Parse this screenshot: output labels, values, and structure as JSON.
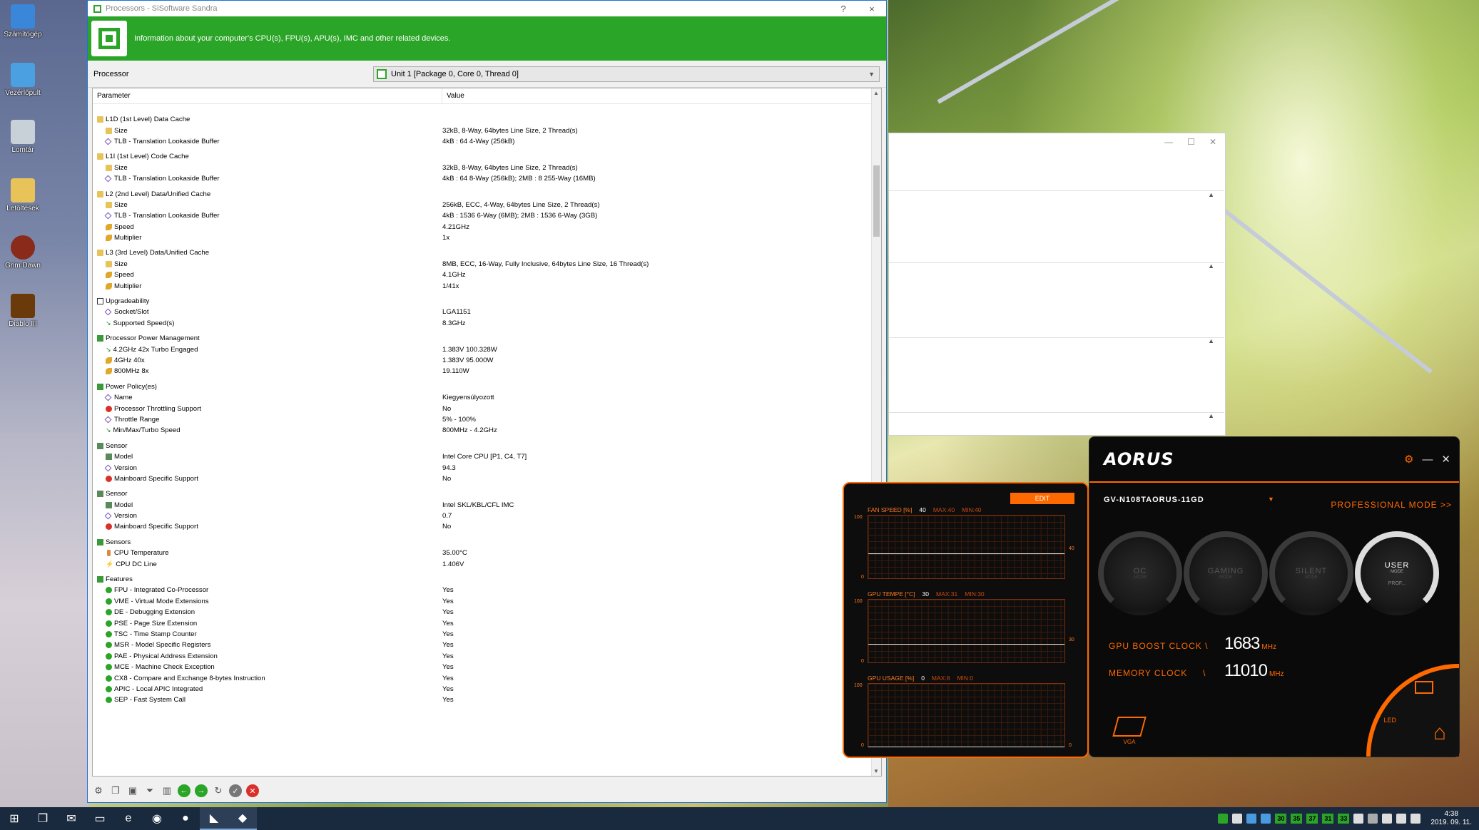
{
  "desktop": {
    "icons": [
      {
        "label": "Számítógép"
      },
      {
        "label": "Vezérlőpult"
      },
      {
        "label": "Lomtár"
      },
      {
        "label": "Letöltések"
      },
      {
        "label": "Grim Dawn"
      },
      {
        "label": "Diablo III"
      }
    ]
  },
  "sandra": {
    "title": "Processors - SiSoftware Sandra",
    "help_btn": "?",
    "close_btn": "×",
    "banner_text": "Information about your computer's CPU(s), FPU(s), APU(s), IMC and other related devices.",
    "processor_label": "Processor",
    "processor_value": "Unit 1 [Package 0, Core 0, Thread 0]",
    "col_param": "Parameter",
    "col_value": "Value",
    "rows": [
      {
        "t": "group",
        "icon": "folder",
        "p": "L1D (1st Level) Data Cache",
        "v": ""
      },
      {
        "t": "item",
        "icon": "folder",
        "p": "Size",
        "v": "32kB, 8-Way, 64bytes Line Size, 2 Thread(s)"
      },
      {
        "t": "item",
        "icon": "tlb",
        "p": "TLB - Translation Lookaside Buffer",
        "v": "4kB : 64 4-Way (256kB)"
      },
      {
        "t": "group",
        "icon": "folder",
        "p": "L1I (1st Level) Code Cache",
        "v": ""
      },
      {
        "t": "item",
        "icon": "folder",
        "p": "Size",
        "v": "32kB, 8-Way, 64bytes Line Size, 2 Thread(s)"
      },
      {
        "t": "item",
        "icon": "tlb",
        "p": "TLB - Translation Lookaside Buffer",
        "v": "4kB : 64 8-Way (256kB); 2MB : 8 255-Way (16MB)"
      },
      {
        "t": "group",
        "icon": "folder",
        "p": "L2 (2nd Level) Data/Unified Cache",
        "v": ""
      },
      {
        "t": "item",
        "icon": "folder",
        "p": "Size",
        "v": "256kB, ECC, 4-Way, 64bytes Line Size, 2 Thread(s)"
      },
      {
        "t": "item",
        "icon": "tlb",
        "p": "TLB - Translation Lookaside Buffer",
        "v": "4kB : 1536 6-Way (6MB); 2MB : 1536 6-Way (3GB)"
      },
      {
        "t": "item",
        "icon": "speed",
        "p": "Speed",
        "v": "4.21GHz"
      },
      {
        "t": "item",
        "icon": "speed",
        "p": "Multiplier",
        "v": "1x"
      },
      {
        "t": "group",
        "icon": "folder",
        "p": "L3 (3rd Level) Data/Unified Cache",
        "v": ""
      },
      {
        "t": "item",
        "icon": "folder",
        "p": "Size",
        "v": "8MB, ECC, 16-Way, Fully Inclusive, 64bytes Line Size, 16 Thread(s)"
      },
      {
        "t": "item",
        "icon": "speed",
        "p": "Speed",
        "v": "4.1GHz"
      },
      {
        "t": "item",
        "icon": "speed",
        "p": "Multiplier",
        "v": "1/41x"
      },
      {
        "t": "group",
        "icon": "box",
        "p": "Upgradeability",
        "v": ""
      },
      {
        "t": "item",
        "icon": "tlb",
        "p": "Socket/Slot",
        "v": "LGA1151"
      },
      {
        "t": "item",
        "icon": "arrow",
        "p": "Supported Speed(s)",
        "v": "8.3GHz"
      },
      {
        "t": "group",
        "icon": "power",
        "p": "Processor Power Management",
        "v": ""
      },
      {
        "t": "item",
        "icon": "arrow",
        "p": "4.2GHz 42x Turbo Engaged",
        "v": "1.383V 100.328W"
      },
      {
        "t": "item",
        "icon": "speed",
        "p": "4GHz 40x",
        "v": "1.383V 95.000W"
      },
      {
        "t": "item",
        "icon": "speed",
        "p": "800MHz 8x",
        "v": "19.110W"
      },
      {
        "t": "group",
        "icon": "power",
        "p": "Power Policy(es)",
        "v": ""
      },
      {
        "t": "item",
        "icon": "tlb",
        "p": "Name",
        "v": "Kiegyensúlyozott"
      },
      {
        "t": "item",
        "icon": "no",
        "p": "Processor Throttling Support",
        "v": "No"
      },
      {
        "t": "item",
        "icon": "tlb",
        "p": "Throttle Range",
        "v": "5% - 100%"
      },
      {
        "t": "item",
        "icon": "arrow",
        "p": "Min/Max/Turbo Speed",
        "v": "800MHz - 4.2GHz"
      },
      {
        "t": "group",
        "icon": "sensor",
        "p": "Sensor",
        "v": ""
      },
      {
        "t": "item",
        "icon": "sensor",
        "p": "Model",
        "v": "Intel Core CPU [P1, C4, T7]"
      },
      {
        "t": "item",
        "icon": "tlb",
        "p": "Version",
        "v": "94.3"
      },
      {
        "t": "item",
        "icon": "no",
        "p": "Mainboard Specific Support",
        "v": "No"
      },
      {
        "t": "group",
        "icon": "sensor",
        "p": "Sensor",
        "v": ""
      },
      {
        "t": "item",
        "icon": "sensor",
        "p": "Model",
        "v": "Intel SKL/KBL/CFL IMC"
      },
      {
        "t": "item",
        "icon": "tlb",
        "p": "Version",
        "v": "0.7"
      },
      {
        "t": "item",
        "icon": "no",
        "p": "Mainboard Specific Support",
        "v": "No"
      },
      {
        "t": "group",
        "icon": "power",
        "p": "Sensors",
        "v": ""
      },
      {
        "t": "item",
        "icon": "temp",
        "p": "CPU Temperature",
        "v": "35.00°C"
      },
      {
        "t": "item",
        "icon": "bolt",
        "p": "CPU DC Line",
        "v": "1.406V"
      },
      {
        "t": "group",
        "icon": "power",
        "p": "Features",
        "v": ""
      },
      {
        "t": "item",
        "icon": "ok",
        "p": "FPU - Integrated Co-Processor",
        "v": "Yes"
      },
      {
        "t": "item",
        "icon": "ok",
        "p": "VME - Virtual Mode Extensions",
        "v": "Yes"
      },
      {
        "t": "item",
        "icon": "ok",
        "p": "DE - Debugging Extension",
        "v": "Yes"
      },
      {
        "t": "item",
        "icon": "ok",
        "p": "PSE - Page Size Extension",
        "v": "Yes"
      },
      {
        "t": "item",
        "icon": "ok",
        "p": "TSC - Time Stamp Counter",
        "v": "Yes"
      },
      {
        "t": "item",
        "icon": "ok",
        "p": "MSR - Model Specific Registers",
        "v": "Yes"
      },
      {
        "t": "item",
        "icon": "ok",
        "p": "PAE - Physical Address Extension",
        "v": "Yes"
      },
      {
        "t": "item",
        "icon": "ok",
        "p": "MCE - Machine Check Exception",
        "v": "Yes"
      },
      {
        "t": "item",
        "icon": "ok",
        "p": "CX8 - Compare and Exchange 8-bytes Instruction",
        "v": "Yes"
      },
      {
        "t": "item",
        "icon": "ok",
        "p": "APIC - Local APIC Integrated",
        "v": "Yes"
      },
      {
        "t": "item",
        "icon": "ok",
        "p": "SEP - Fast System Call",
        "v": "Yes"
      }
    ]
  },
  "aorus_graph": {
    "edit_label": "EDIT",
    "fan": {
      "label": "FAN SPEED [%]",
      "value": "40",
      "max": "MAX:40",
      "min": "MIN:40",
      "y_top": "100",
      "y_bottom": "0",
      "marker": "40",
      "level": 0.4
    },
    "temp": {
      "label": "GPU TEMPE [°C]",
      "value": "30",
      "max": "MAX:31",
      "min": "MIN:30",
      "y_top": "100",
      "y_bottom": "0",
      "marker": "30",
      "level": 0.3
    },
    "usage": {
      "label": "GPU USAGE [%]",
      "value": "0",
      "max": "MAX:8",
      "min": "MIN:0",
      "y_top": "100",
      "y_bottom": "0",
      "marker": "0",
      "level": 0.0
    }
  },
  "aorus_main": {
    "logo": "AORUS",
    "model": "GV-N108TAORUS-11GD",
    "pro_mode": "PROFESSIONAL MODE >>",
    "modes": [
      {
        "name": "OC",
        "sub": "MODE"
      },
      {
        "name": "GAMING",
        "sub": "MODE"
      },
      {
        "name": "SILENT",
        "sub": "MODE"
      },
      {
        "name": "USER",
        "sub": "MODE",
        "extra": "PROF..."
      }
    ],
    "boost_label": "GPU BOOST CLOCK \\",
    "boost_value": "1683",
    "boost_unit": "MHz",
    "mem_label": "MEMORY CLOCK",
    "mem_sep": "\\",
    "mem_value": "11010",
    "mem_unit": "MHz",
    "vga_label": "VGA",
    "led_label": "LED"
  },
  "taskbar": {
    "tray_numbers": [
      "30",
      "35",
      "37",
      "31",
      "33"
    ],
    "time": "4:38",
    "date": "2019. 09. 11."
  },
  "colors": {
    "sandra_green": "#2aa527",
    "aorus_orange": "#ff6a00"
  }
}
